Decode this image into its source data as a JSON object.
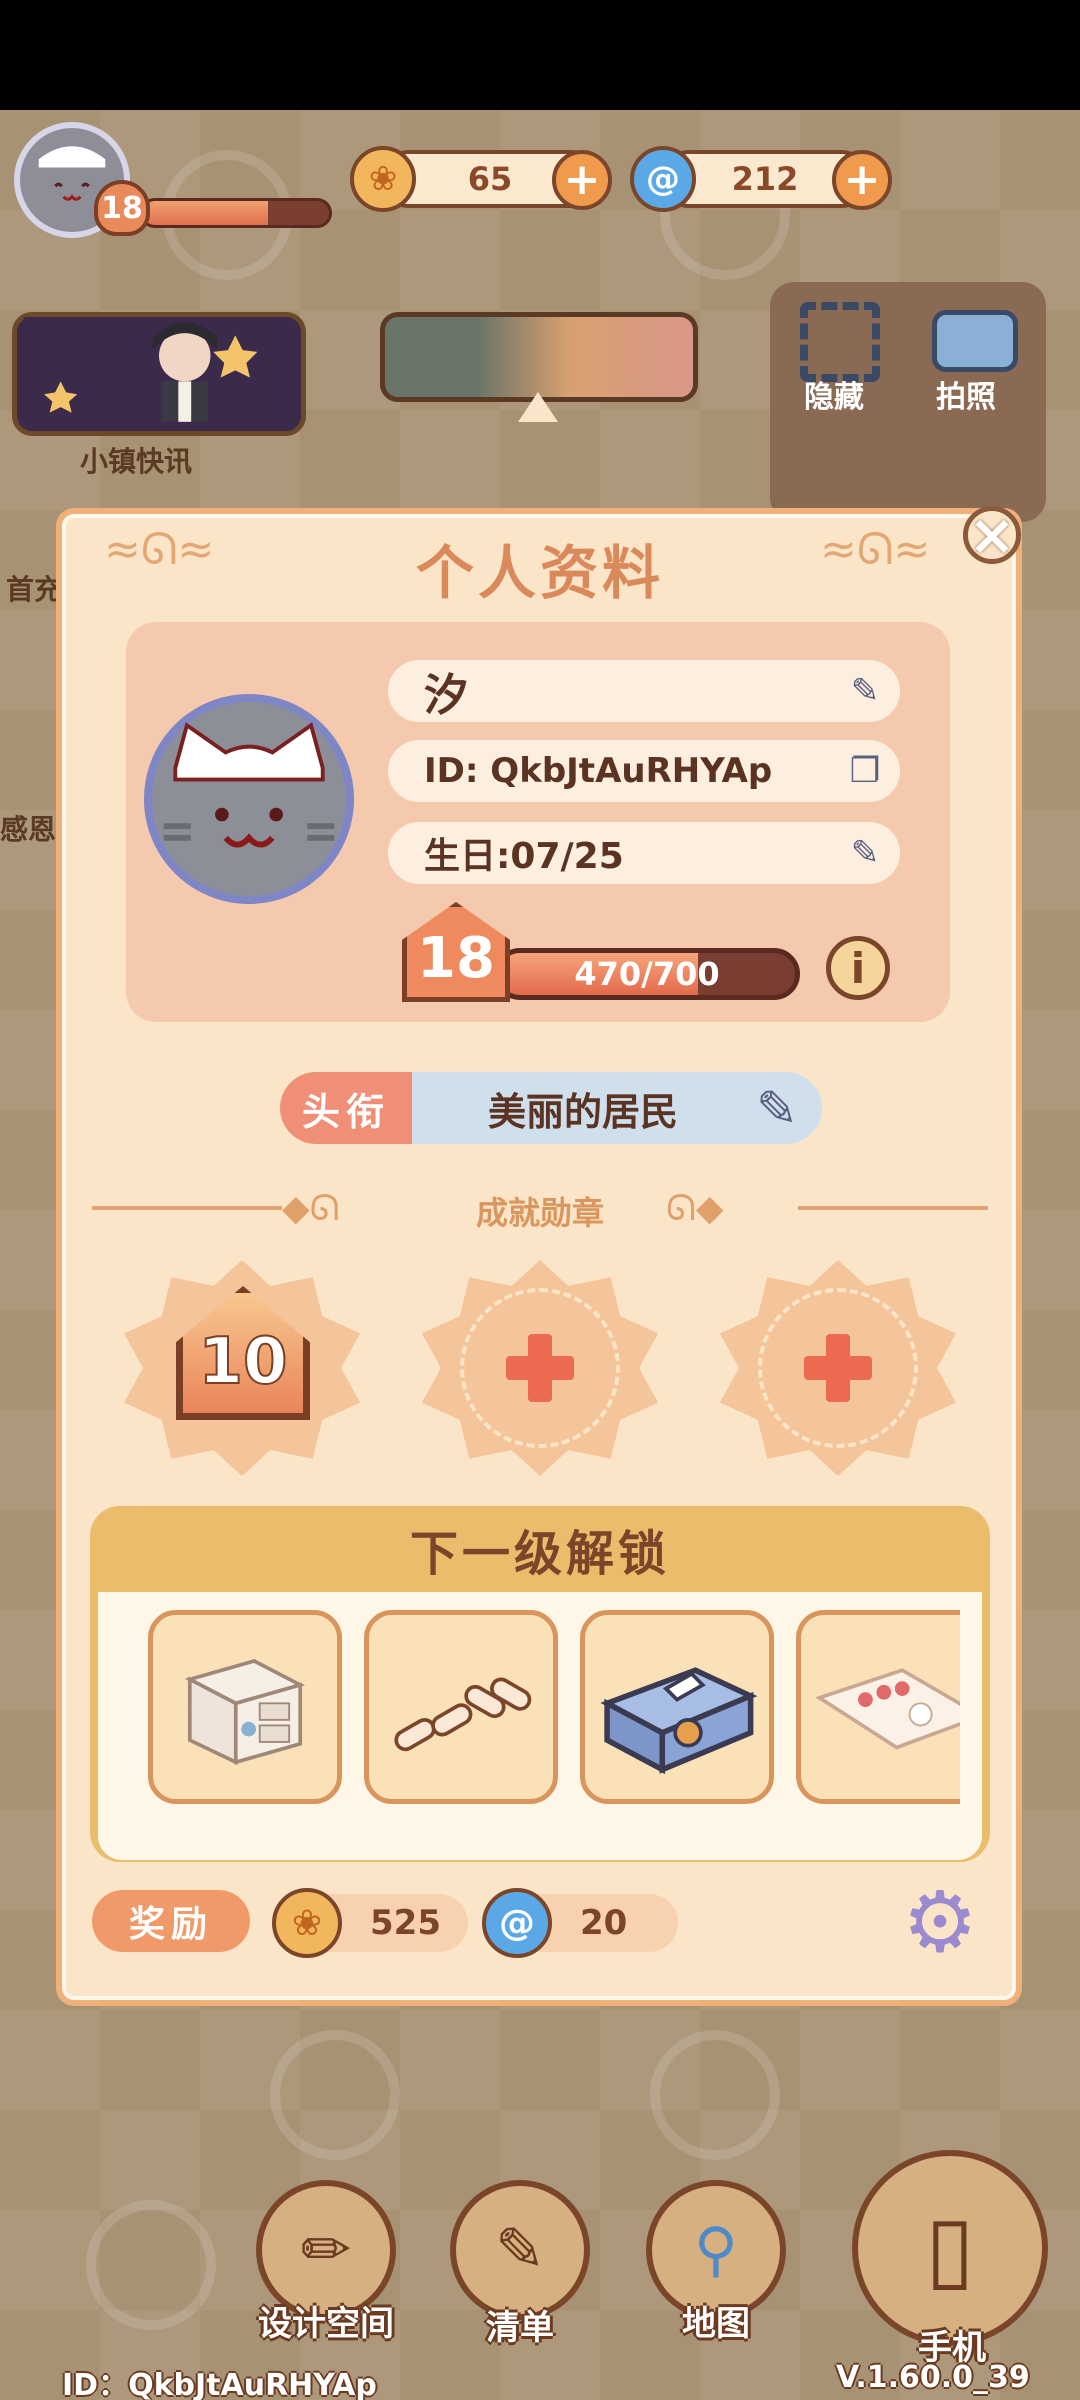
{
  "hud": {
    "level": "18",
    "level_progress": 0.6714,
    "currencies": [
      {
        "name": "gold-coin",
        "value": "65"
      },
      {
        "name": "blue-swirl-gem",
        "value": "212"
      }
    ]
  },
  "left_panel": {
    "news_label": "小镇快讯",
    "partial_labels": [
      "首充",
      "感恩"
    ]
  },
  "right_panel": {
    "hide_label": "隐藏",
    "photo_label": "拍照"
  },
  "profile": {
    "title": "个人资料",
    "name": "汐",
    "id_text": "ID: QkbJtAuRHYAp",
    "birthday": "生日:07/25",
    "level": "18",
    "xp_text": "470/700",
    "xp_progress": 0.6714,
    "honor_tag": "头衔",
    "honor_value": "美丽的居民",
    "achievements_label": "成就勋章",
    "achievement_badges": [
      {
        "type": "medal",
        "value": "10"
      },
      {
        "type": "empty-slot"
      },
      {
        "type": "empty-slot"
      }
    ],
    "unlock_title": "下一级解锁",
    "unlock_items": [
      "cabinet",
      "sausage-links",
      "tissue-box",
      "flower-rug"
    ],
    "reward_tag": "奖励",
    "rewards": [
      {
        "name": "gold-coin",
        "value": "525"
      },
      {
        "name": "blue-swirl-gem",
        "value": "20"
      }
    ]
  },
  "bottom_nav": [
    {
      "label": "设计空间",
      "icon": "design-space-icon"
    },
    {
      "label": "清单",
      "icon": "checklist-icon"
    },
    {
      "label": "地图",
      "icon": "map-pin-icon"
    },
    {
      "label": "手机",
      "icon": "phone-icon"
    }
  ],
  "footer": {
    "id_text": "ID：QkbJtAuRHYAp",
    "version": "V.1.60.0_39"
  },
  "colors": {
    "accent_orange": "#f09a4e",
    "panel_cream": "#fbe5c8",
    "brown_outline": "#7a4528"
  }
}
